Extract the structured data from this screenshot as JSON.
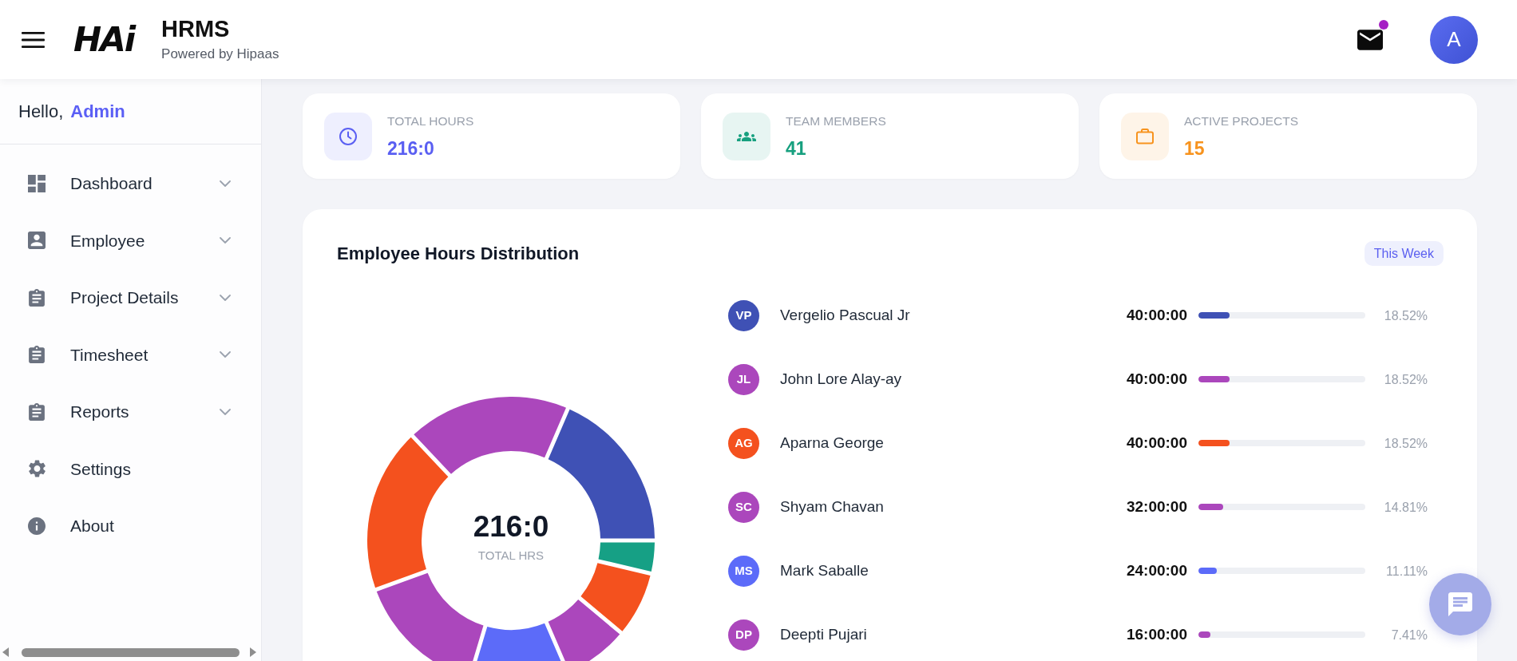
{
  "header": {
    "logo_text": "HAi",
    "title": "HRMS",
    "subtitle": "Powered by Hipaas",
    "mail_unread": true,
    "avatar_initial": "A"
  },
  "sidebar": {
    "greeting": "Hello,",
    "user_name": "Admin",
    "items": [
      {
        "label": "Dashboard",
        "has_submenu": true,
        "selected": false
      },
      {
        "label": "Employee",
        "has_submenu": true,
        "selected": false
      },
      {
        "label": "Project Details",
        "has_submenu": true,
        "selected": false
      },
      {
        "label": "Timesheet",
        "has_submenu": true,
        "selected": false
      },
      {
        "label": "Reports",
        "has_submenu": true,
        "selected": false
      },
      {
        "label": "Settings",
        "has_submenu": false,
        "selected": false
      },
      {
        "label": "About",
        "has_submenu": false,
        "selected": false
      }
    ]
  },
  "stat_cards": [
    {
      "label": "TOTAL HOURS",
      "value": "216:0",
      "color": "#5a5ff2"
    },
    {
      "label": "TEAM MEMBERS",
      "value": "41",
      "color": "#17a07f"
    },
    {
      "label": "ACTIVE PROJECTS",
      "value": "15",
      "color": "#f7931e"
    }
  ],
  "hours_card": {
    "title": "Employee Hours Distribution",
    "period": "This Week",
    "center_value": "216:0",
    "center_label": "TOTAL HRS",
    "employees": [
      {
        "initials": "VP",
        "name": "Vergelio Pascual Jr",
        "hours": "40:00:00",
        "level": 0.1852,
        "percent": "18.52%",
        "color": "#3f51b5"
      },
      {
        "initials": "JL",
        "name": "John Lore Alay-ay",
        "hours": "40:00:00",
        "level": 0.1852,
        "percent": "18.52%",
        "color": "#ab47bc"
      },
      {
        "initials": "AG",
        "name": "Aparna George",
        "hours": "40:00:00",
        "level": 0.1852,
        "percent": "18.52%",
        "color": "#f4511e"
      },
      {
        "initials": "SC",
        "name": "Shyam Chavan",
        "hours": "32:00:00",
        "level": 0.1481,
        "percent": "14.81%",
        "color": "#ab47bc"
      },
      {
        "initials": "MS",
        "name": "Mark Saballe",
        "hours": "24:00:00",
        "level": 0.1111,
        "percent": "11.11%",
        "color": "#5c6bf9"
      },
      {
        "initials": "DP",
        "name": "Deepti Pujari",
        "hours": "16:00:00",
        "level": 0.0741,
        "percent": "7.41%",
        "color": "#ab47bc"
      }
    ]
  }
}
